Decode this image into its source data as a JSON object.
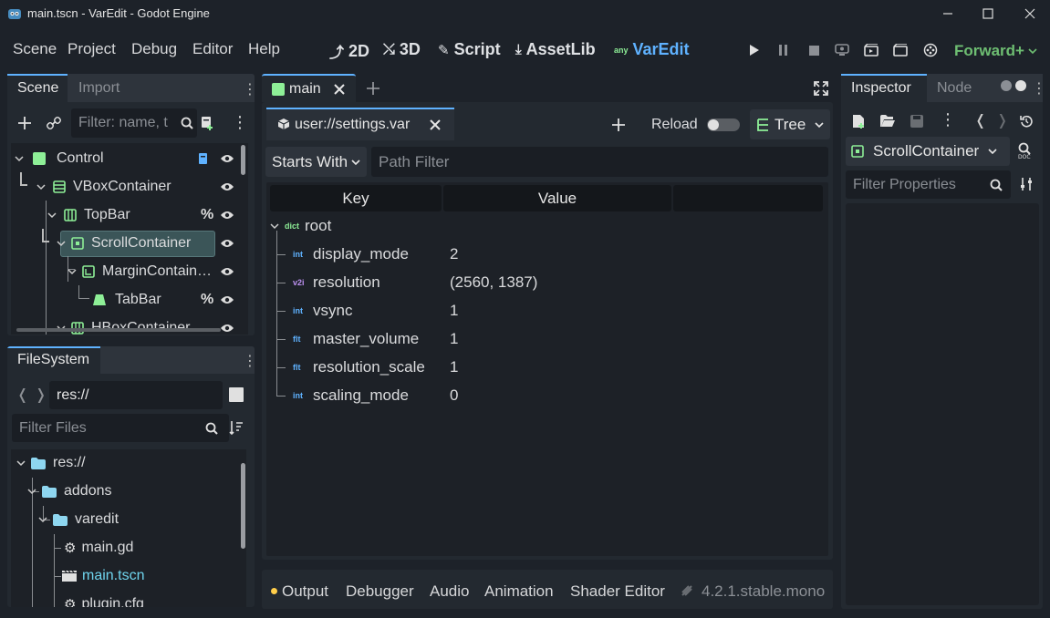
{
  "window": {
    "title": "main.tscn - VarEdit - Godot Engine"
  },
  "menu": {
    "items": [
      "Scene",
      "Project",
      "Debug",
      "Editor",
      "Help"
    ]
  },
  "workspaces": {
    "w2d": "2D",
    "w3d": "3D",
    "script": "Script",
    "assetlib": "AssetLib",
    "varedit_badge": "any",
    "varedit": "VarEdit"
  },
  "renderer": "Forward+",
  "scene_dock": {
    "tab_scene": "Scene",
    "tab_import": "Import",
    "filter_placeholder": "Filter: name, t",
    "nodes": [
      {
        "name": "Control",
        "icon": "control-icon",
        "color": "#8eef97"
      },
      {
        "name": "VBoxContainer",
        "icon": "vbox-icon",
        "color": "#8eef97"
      },
      {
        "name": "TopBar",
        "icon": "hbox-icon",
        "color": "#8eef97",
        "badge": "%"
      },
      {
        "name": "ScrollContainer",
        "icon": "scroll-icon",
        "color": "#8eef97",
        "selected": true
      },
      {
        "name": "MarginContain…",
        "icon": "margin-icon",
        "color": "#8eef97"
      },
      {
        "name": "TabBar",
        "icon": "tabbar-icon",
        "color": "#8eef97",
        "badge": "%"
      },
      {
        "name": "HBoxContainer",
        "icon": "hbox-icon",
        "color": "#8eef97"
      }
    ]
  },
  "filesystem": {
    "tab": "FileSystem",
    "path": "res://",
    "filter_placeholder": "Filter Files",
    "items": [
      {
        "name": "res://",
        "type": "folder"
      },
      {
        "name": "addons",
        "type": "folder"
      },
      {
        "name": "varedit",
        "type": "folder"
      },
      {
        "name": "main.gd",
        "type": "gear"
      },
      {
        "name": "main.tscn",
        "type": "scene",
        "highlight": true
      },
      {
        "name": "plugin.cfg",
        "type": "gear"
      }
    ]
  },
  "editor": {
    "tab": "main",
    "file_tab": "user://settings.var",
    "reload": "Reload",
    "view_mode": "Tree",
    "match_mode": "Starts With",
    "path_filter_placeholder": "Path Filter",
    "col_key": "Key",
    "col_value": "Value",
    "root": {
      "type": "dict",
      "key": "root"
    },
    "rows": [
      {
        "type": "int",
        "key": "display_mode",
        "value": "2"
      },
      {
        "type": "v2i",
        "key": "resolution",
        "value": "(2560, 1387)"
      },
      {
        "type": "int",
        "key": "vsync",
        "value": "1"
      },
      {
        "type": "flt",
        "key": "master_volume",
        "value": "1"
      },
      {
        "type": "flt",
        "key": "resolution_scale",
        "value": "1"
      },
      {
        "type": "int",
        "key": "scaling_mode",
        "value": "0"
      }
    ]
  },
  "bottom": {
    "output": "Output",
    "debugger": "Debugger",
    "audio": "Audio",
    "animation": "Animation",
    "shader": "Shader Editor",
    "version": "4.2.1.stable.mono"
  },
  "inspector": {
    "tab_inspector": "Inspector",
    "tab_node": "Node",
    "selected": "ScrollContainer",
    "filter_placeholder": "Filter Properties"
  },
  "colors": {
    "accent": "#5fb2ff",
    "green": "#8eef97",
    "type_int": "#5fb2ff",
    "type_v2i": "#bd91f1",
    "type_dict": "#8eef97",
    "selected_bg": "#3b5558"
  }
}
